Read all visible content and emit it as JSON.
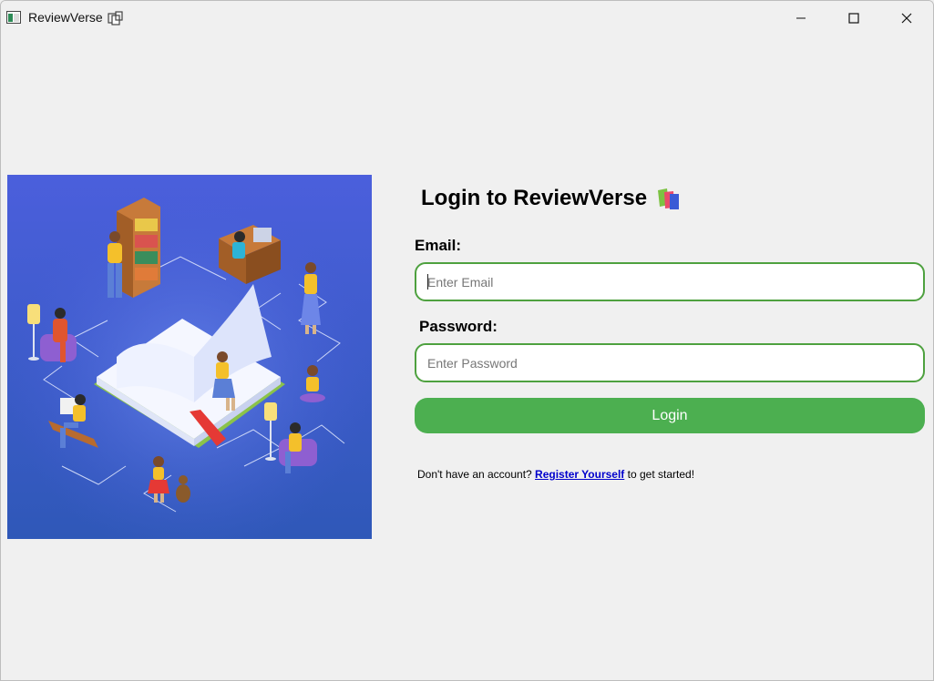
{
  "window": {
    "title": "ReviewVerse",
    "title_emoji_icon": "books-icon",
    "controls": [
      "minimize-icon",
      "maximize-icon",
      "close-icon"
    ]
  },
  "illustration": {
    "icon": "library-reading-illustration",
    "background": "#4a5fd8"
  },
  "login": {
    "heading": "Login to ReviewVerse",
    "heading_icon": "books-icon",
    "email_label": "Email:",
    "email_placeholder": "Enter Email",
    "password_label": "Password:",
    "password_placeholder": "Enter Password",
    "login_button": "Login",
    "register_prefix": "Don't have an account? ",
    "register_link": "Register Yourself",
    "register_suffix": " to get started!"
  },
  "colors": {
    "accent": "#4caf50",
    "field_border": "#4ea13f",
    "link": "#0000cc",
    "background": "#f0f0f0"
  }
}
